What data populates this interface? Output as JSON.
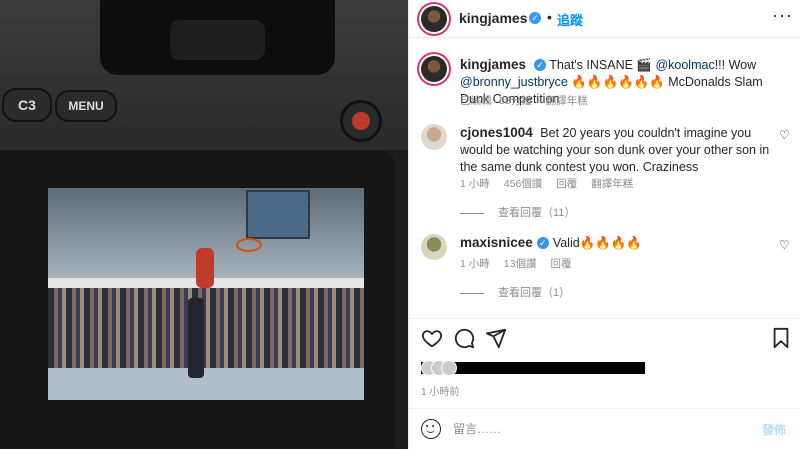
{
  "photo": {
    "camera_button_c3": "C3",
    "camera_button_menu": "MENU"
  },
  "header": {
    "username": "kingjames",
    "follow_label": "追蹤",
    "separator": "•",
    "more_label": "···"
  },
  "caption": {
    "username": "kingjames",
    "text_before": "That's INSANE 🎬 ",
    "mention1": "@koolmac",
    "text_mid": "!!! Wow ",
    "mention2": "@bronny_justbryce",
    "text_after": " 🔥🔥🔥🔥🔥🔥 McDonalds Slam Dunk Competition",
    "edited": "已編輯",
    "dot": "·",
    "time": "55分鐘",
    "translate": "翻譯年糕"
  },
  "comments": [
    {
      "username": "cjones1004",
      "text": "Bet 20 years you couldn't imagine you would be watching your son dunk over your other son in the same dunk contest you won. Craziness",
      "time": "1 小時",
      "likes": "456個讚",
      "reply": "回覆",
      "translate": "翻譯年糕",
      "view_replies": "查看回覆（11）"
    },
    {
      "username": "maxisnicee",
      "text": "Valid🔥🔥🔥🔥",
      "time": "1 小時",
      "likes": "13個讚",
      "reply": "回覆",
      "view_replies": "查看回覆（1）"
    }
  ],
  "icons": {
    "like": "heart-icon",
    "comment": "comment-icon",
    "share": "share-icon",
    "save": "bookmark-icon",
    "emoji": "emoji-icon"
  },
  "post_time": "1 小時前",
  "comment_box": {
    "placeholder": "留言……",
    "post_label": "發佈"
  },
  "colors": {
    "link": "#00376b",
    "follow": "#0095f6",
    "verified": "#3897f0",
    "muted": "#8e8e8e"
  }
}
